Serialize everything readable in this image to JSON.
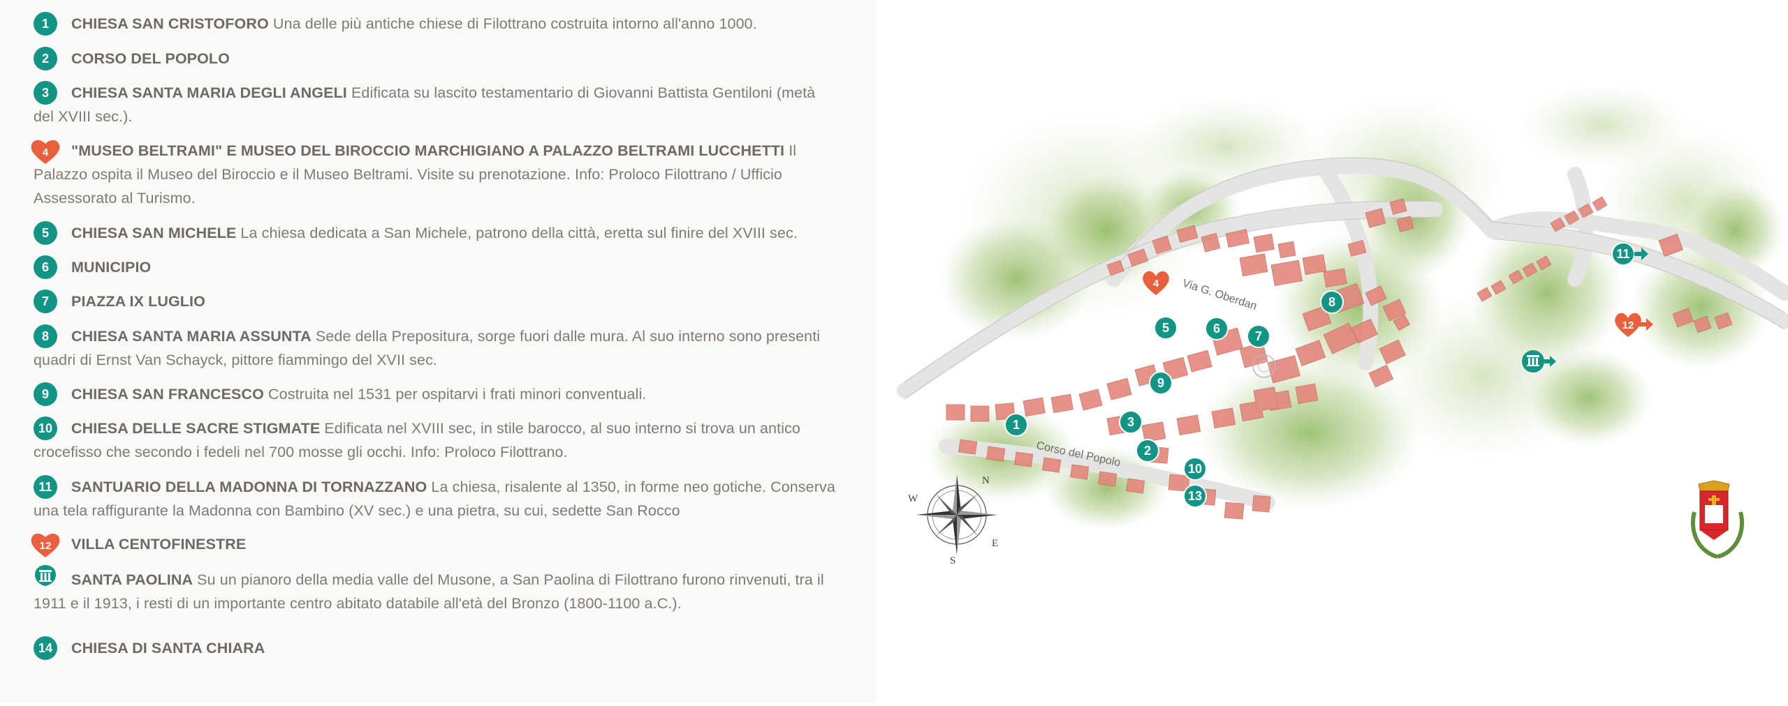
{
  "pois": [
    {
      "marker": "number",
      "num": "1",
      "title": "CHIESA SAN CRISTOFORO",
      "desc": "Una delle più antiche chiese di Filottrano costruita intorno all'anno 1000."
    },
    {
      "marker": "number",
      "num": "2",
      "title": "CORSO DEL POPOLO",
      "desc": ""
    },
    {
      "marker": "number",
      "num": "3",
      "title": "CHIESA SANTA MARIA DEGLI ANGELI",
      "desc": "Edificata su lascito testamentario di Giovanni Battista Gentiloni (metà del XVIII sec.)."
    },
    {
      "marker": "heart",
      "num": "4",
      "title": "\"MUSEO BELTRAMI\" E MUSEO DEL BIROCCIO MARCHIGIANO A PALAZZO BELTRAMI LUCCHETTI",
      "desc": "Il Palazzo ospita il Museo del Biroccio e il Museo Beltrami. Visite su prenotazione. Info: Proloco Filottrano / Ufficio Assessorato al Turismo."
    },
    {
      "marker": "number",
      "num": "5",
      "title": "CHIESA SAN MICHELE",
      "desc": "La chiesa dedicata a San Michele, patrono della città, eretta sul finire del XVIII sec."
    },
    {
      "marker": "number",
      "num": "6",
      "title": "MUNICIPIO",
      "desc": ""
    },
    {
      "marker": "number",
      "num": "7",
      "title": "PIAZZA IX LUGLIO",
      "desc": ""
    },
    {
      "marker": "number",
      "num": "8",
      "title": "CHIESA SANTA MARIA ASSUNTA",
      "desc": "Sede della Prepositura, sorge fuori dalle mura. Al suo interno sono presenti quadri di Ernst Van Schayck, pittore fiammingo del XVII sec."
    },
    {
      "marker": "number",
      "num": "9",
      "title": "CHIESA SAN FRANCESCO",
      "desc": "Costruita nel 1531 per ospitarvi i frati minori conventuali."
    },
    {
      "marker": "number",
      "num": "10",
      "title": "CHIESA DELLE SACRE STIGMATE",
      "desc": "Edificata nel XVIII sec, in stile barocco, al suo interno si trova un antico crocefisso che secondo i fedeli nel 700 mosse gli occhi. Info: Proloco Filottrano."
    },
    {
      "marker": "number",
      "num": "11",
      "title": "SANTUARIO DELLA MADONNA DI TORNAZZANO",
      "desc": "La chiesa, risalente al 1350, in forme neo gotiche. Conserva una tela raffigurante la Madonna con Bambino (XV sec.) e una pietra, su cui, sedette San Rocco"
    },
    {
      "marker": "heart",
      "num": "12",
      "title": "VILLA CENTOFINESTRE",
      "desc": ""
    },
    {
      "marker": "ruins",
      "num": "",
      "title": "SANTA PAOLINA",
      "desc": "Su un pianoro della media valle del Musone, a San Paolina di Filottrano furono rinvenuti, tra il 1911 e il 1913, i resti di un importante centro abitato databile all'età del Bronzo (1800-1100 a.C.)."
    },
    {
      "marker": "number",
      "num": "14",
      "title": "CHIESA DI SANTA CHIARA",
      "desc": ""
    }
  ],
  "map": {
    "street_labels": {
      "oberdan": "Via G. Oberdan",
      "corso": "Corso del Popolo"
    },
    "compass": {
      "n": "N",
      "s": "S",
      "e": "E",
      "w": "W"
    },
    "pins": [
      "1",
      "2",
      "3",
      "4",
      "5",
      "6",
      "7",
      "8",
      "9",
      "10",
      "11",
      "12",
      "13"
    ]
  },
  "colors": {
    "teal": "#129585",
    "heart": "#e8603c",
    "roof": "#e3867b",
    "green": "#9cbf72"
  }
}
